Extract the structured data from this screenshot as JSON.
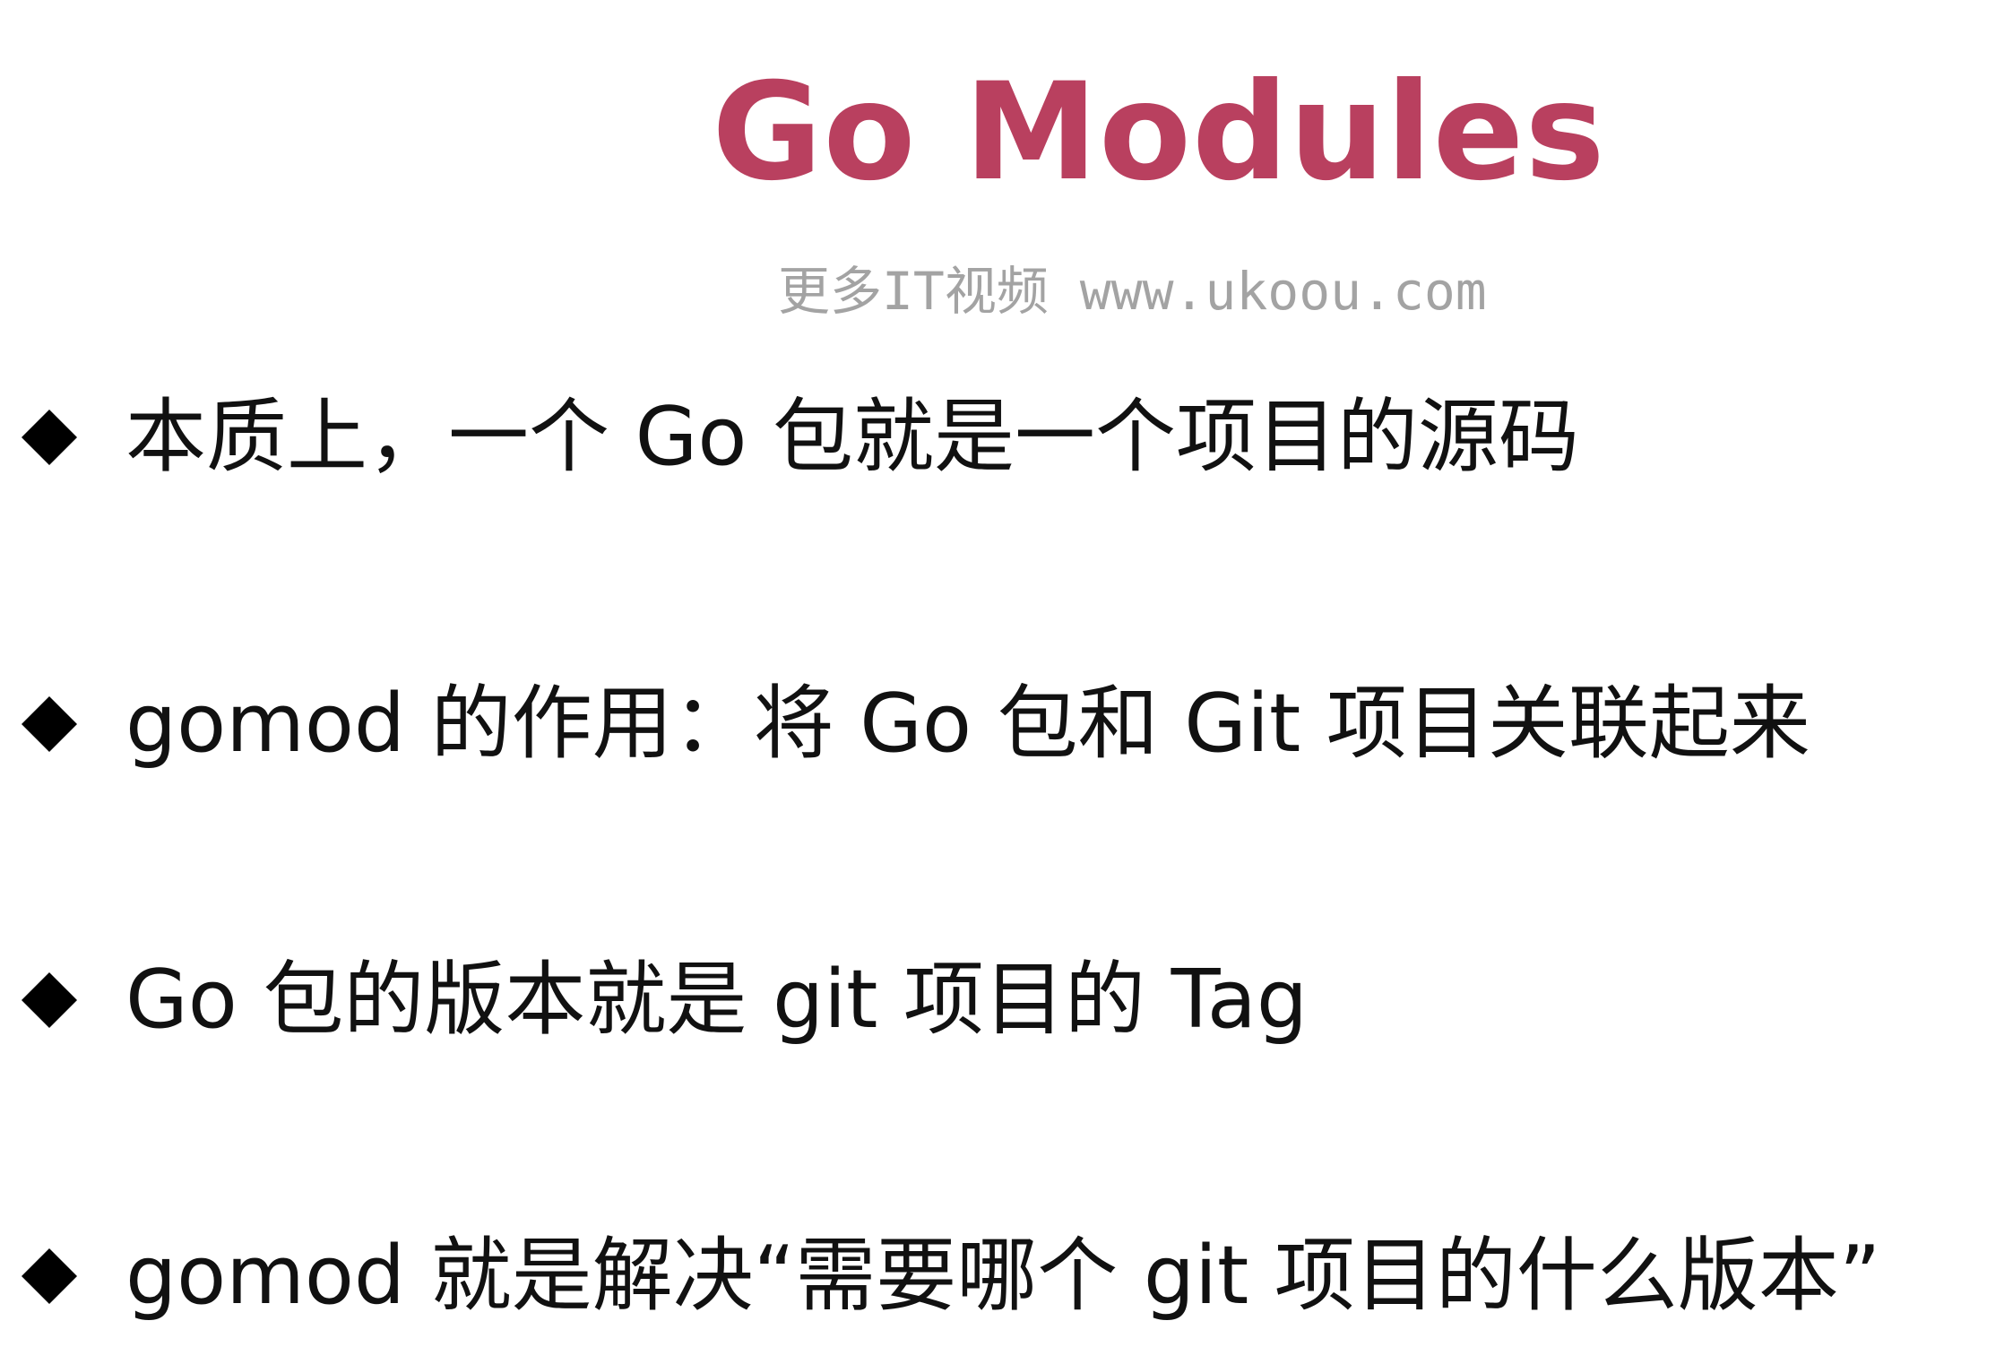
{
  "slide": {
    "title": "Go Modules",
    "watermark": "更多IT视频 www.ukoou.com",
    "bullets": [
      "本质上，一个 Go 包就是一个项目的源码",
      "gomod 的作用：将 Go 包和 Git 项目关联起来",
      "Go 包的版本就是 git 项目的 Tag",
      "gomod 就是解决“需要哪个 git 项目的什么版本”"
    ],
    "colors": {
      "title": "#b9405f",
      "text": "#111111",
      "watermark": "#a3a3a3",
      "background": "#ffffff"
    },
    "icons": {
      "bullet": "diamond-bullet-icon"
    }
  }
}
